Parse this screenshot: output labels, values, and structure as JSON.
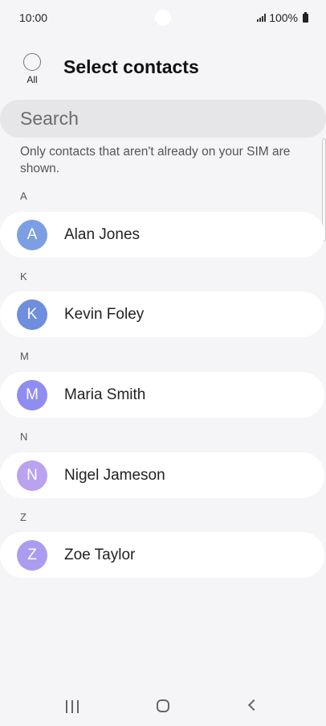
{
  "status": {
    "time": "10:00",
    "battery": "100%"
  },
  "header": {
    "all_label": "All",
    "title": "Select contacts"
  },
  "search": {
    "placeholder": "Search"
  },
  "info_text": "Only contacts that aren't already on your SIM are shown.",
  "sections": [
    {
      "letter": "A",
      "contact": {
        "initial": "A",
        "name": "Alan Jones",
        "color": "#7b9fe2"
      }
    },
    {
      "letter": "K",
      "contact": {
        "initial": "K",
        "name": "Kevin Foley",
        "color": "#6f8ede"
      }
    },
    {
      "letter": "M",
      "contact": {
        "initial": "M",
        "name": "Maria Smith",
        "color": "#8f8df0"
      }
    },
    {
      "letter": "N",
      "contact": {
        "initial": "N",
        "name": "Nigel Jameson",
        "color": "#b9a2ee"
      }
    },
    {
      "letter": "Z",
      "contact": {
        "initial": "Z",
        "name": "Zoe Taylor",
        "color": "#ac9cf0"
      }
    }
  ],
  "navbar": {
    "icons": [
      "recents-icon",
      "home-icon",
      "back-icon"
    ]
  }
}
